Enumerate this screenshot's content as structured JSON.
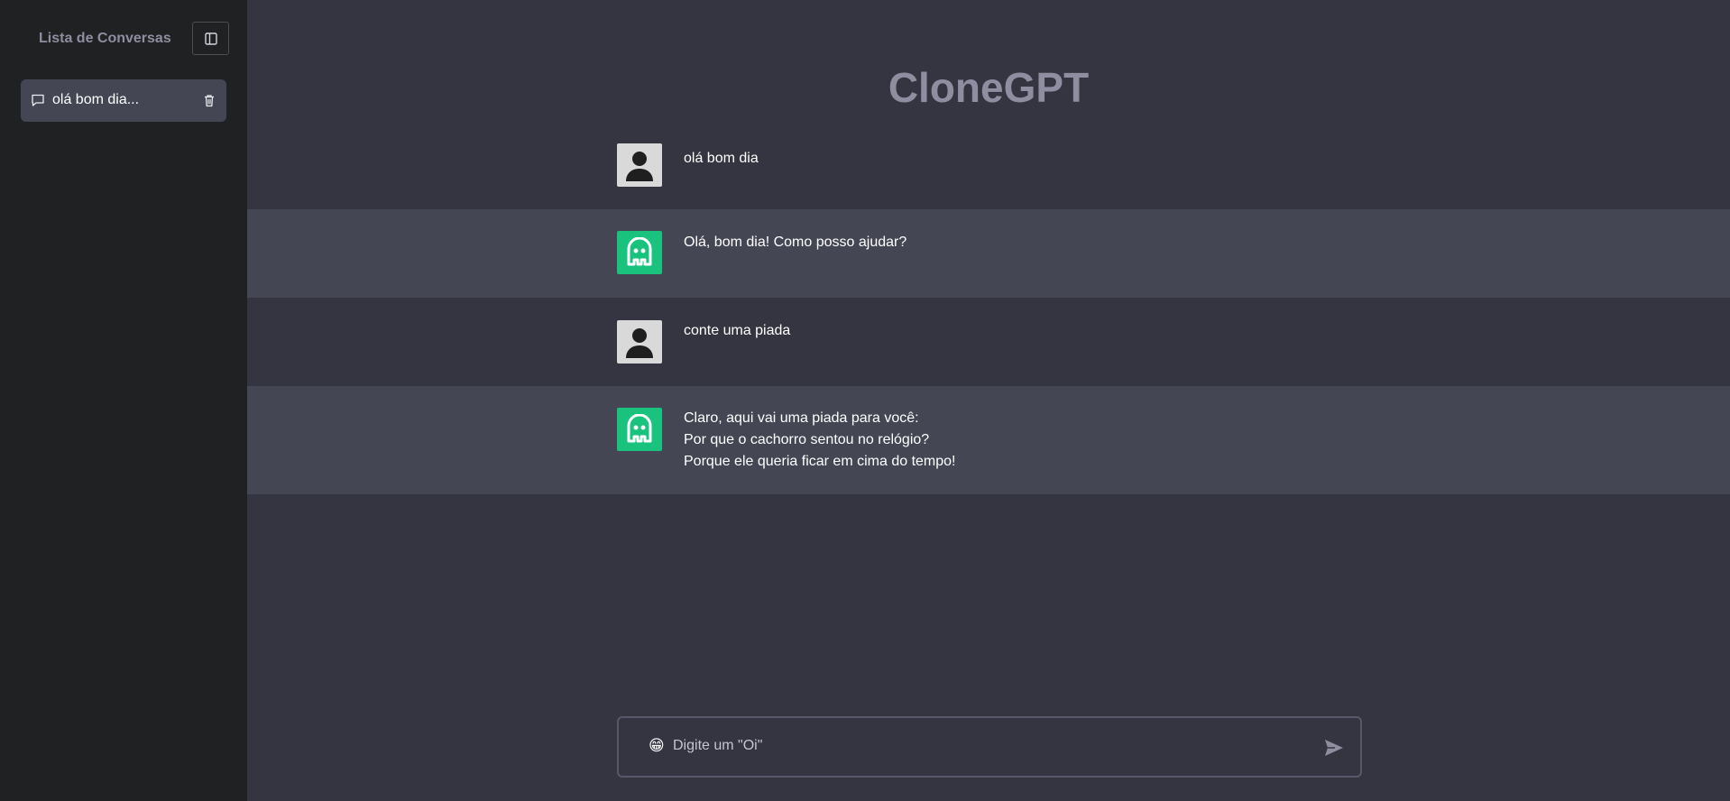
{
  "sidebar": {
    "title": "Lista de Conversas",
    "toggle_icon": "sidebar-toggle-icon",
    "conversations": [
      {
        "label": "olá bom dia...",
        "icon": "chat-bubble-icon",
        "action_icon": "trash-icon"
      }
    ]
  },
  "main": {
    "title": "CloneGPT",
    "messages": [
      {
        "role": "user",
        "avatar_icon": "user-silhouette-icon",
        "text": "olá bom dia"
      },
      {
        "role": "bot",
        "avatar_icon": "robot-icon",
        "text": "Olá, bom dia! Como posso ajudar?"
      },
      {
        "role": "user",
        "avatar_icon": "user-silhouette-icon",
        "text": "conte uma piada"
      },
      {
        "role": "bot",
        "avatar_icon": "robot-icon",
        "text": "Claro, aqui vai uma piada para você:\nPor que o cachorro sentou no relógio?\nPorque ele queria ficar em cima do tempo!"
      }
    ]
  },
  "input": {
    "emoji": "😁",
    "placeholder": "Digite um \"Oi\"",
    "value": "",
    "send_icon": "send-icon"
  },
  "colors": {
    "sidebar_bg": "#202123",
    "main_bg": "#343541",
    "bot_row_bg": "#444654",
    "bot_avatar": "#19c37d",
    "title": "#8e8ea0"
  }
}
